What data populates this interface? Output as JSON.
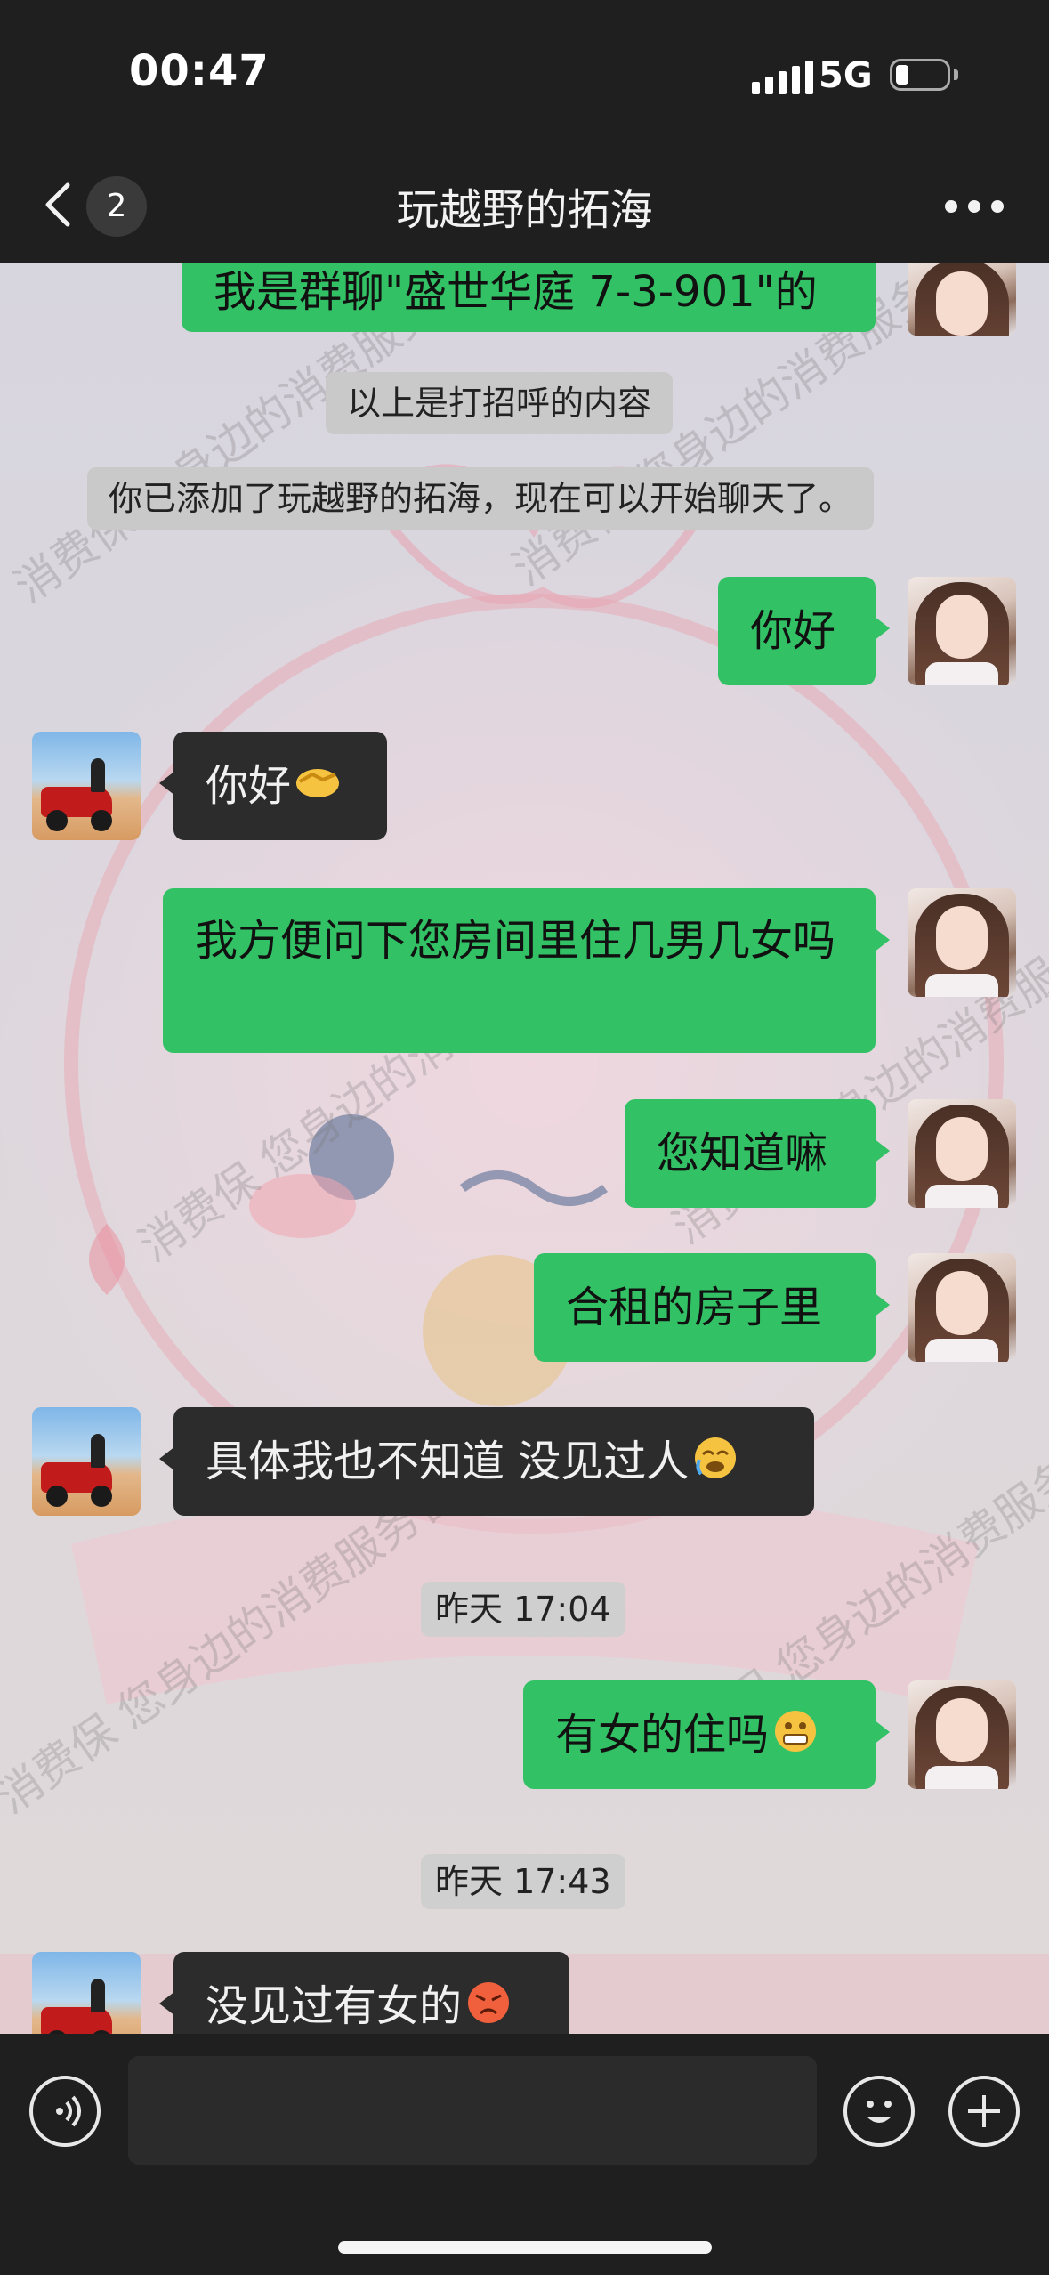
{
  "status": {
    "time": "00:47",
    "network": "5G"
  },
  "nav": {
    "back_count": "2",
    "title": "玩越野的拓海"
  },
  "messages": {
    "greeting_intro": "我是群聊\"盛世华庭 7-3-901\"的",
    "sys_greeting_note": "以上是打招呼的内容",
    "sys_added": "你已添加了玩越野的拓海，现在可以开始聊天了。",
    "m1": "你好",
    "m2": "你好",
    "m3": "我方便问下您房间里住几男几女吗",
    "m4": "您知道嘛",
    "m5": "合租的房子里",
    "m6": "具体我也不知道 没见过人",
    "ts1": "昨天 17:04",
    "m7": "有女的住吗",
    "ts2": "昨天 17:43",
    "m8": "没见过有女的"
  },
  "watermark": {
    "text": "消费保 您身边的消费服务管家"
  },
  "colors": {
    "outgoing_bubble": "#33c165",
    "incoming_bubble": "#2c2c2c",
    "bar_bg": "#1f1f1f"
  },
  "icons": {
    "back": "chevron-left-icon",
    "more": "more-dots-icon",
    "voice": "voice-icon",
    "emoji": "emoji-face-icon",
    "plus": "plus-icon"
  }
}
